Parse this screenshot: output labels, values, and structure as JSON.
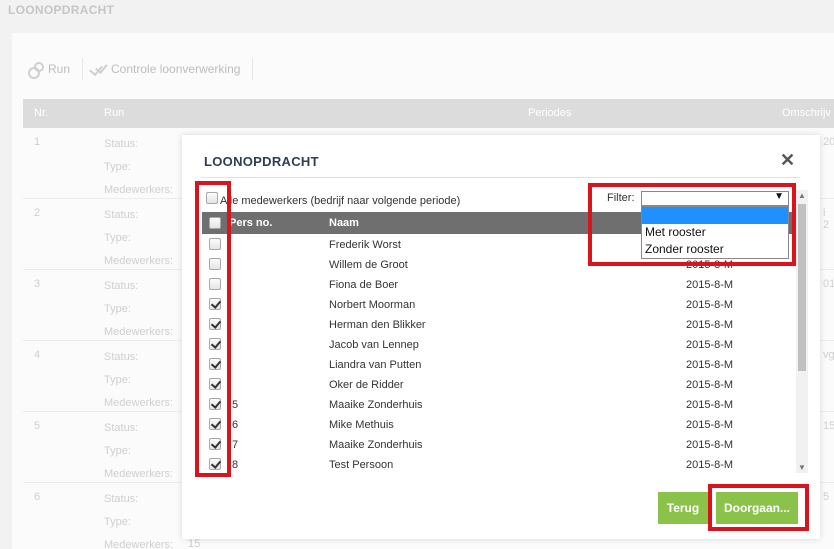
{
  "page": {
    "title": "LOONOPDRACHT",
    "toolbar": {
      "run_label": "Run",
      "check_label": "Controle loonverwerking"
    },
    "table_head": {
      "nr": "Nr.",
      "run": "Run",
      "periodes": "Periodes",
      "omschrijving": "Omschrijv"
    },
    "row_labels": {
      "status": "Status:",
      "type": "Type:",
      "medewerkers": "Medewerkers:"
    },
    "rows": [
      {
        "nr": "1",
        "side": "20"
      },
      {
        "nr": "2",
        "side": "i 2"
      },
      {
        "nr": "3",
        "side": "01"
      },
      {
        "nr": "4",
        "side": "vg"
      },
      {
        "nr": "5",
        "side": "15"
      },
      {
        "nr": "6",
        "side": "5"
      }
    ],
    "last_count": "15"
  },
  "modal": {
    "title": "LOONOPDRACHT",
    "close_symbol": "✕",
    "all_employees_label": "Alle medewerkers (bedrijf naar volgende periode)",
    "filter_label": "Filter:",
    "filter_value": "",
    "filter_arrow": "▼",
    "filter_options": [
      "",
      "Met rooster",
      "Zonder rooster"
    ],
    "columns": {
      "pers": "Pers no.",
      "naam": "Naam"
    },
    "employees": [
      {
        "pers": "",
        "naam": "Frederik Worst",
        "periode": "",
        "checked": false
      },
      {
        "pers": "",
        "naam": "Willem de Groot",
        "periode": "2015-8-M",
        "checked": false
      },
      {
        "pers": "",
        "naam": "Fiona de Boer",
        "periode": "2015-8-M",
        "checked": false
      },
      {
        "pers": "",
        "naam": "Norbert Moorman",
        "periode": "2015-8-M",
        "checked": true
      },
      {
        "pers": "",
        "naam": "Herman den Blikker",
        "periode": "2015-8-M",
        "checked": true
      },
      {
        "pers": "",
        "naam": "Jacob van Lennep",
        "periode": "2015-8-M",
        "checked": true
      },
      {
        "pers": "",
        "naam": "Liandra van Putten",
        "periode": "2015-8-M",
        "checked": true
      },
      {
        "pers": "",
        "naam": "Oker de Ridder",
        "periode": "2015-8-M",
        "checked": true
      },
      {
        "pers": "5",
        "naam": "Maaike Zonderhuis",
        "periode": "2015-8-M",
        "checked": true
      },
      {
        "pers": "6",
        "naam": "Mike Methuis",
        "periode": "2015-8-M",
        "checked": true
      },
      {
        "pers": "7",
        "naam": "Maaike Zonderhuis",
        "periode": "2015-8-M",
        "checked": true
      },
      {
        "pers": "8",
        "naam": "Test Persoon",
        "periode": "2015-8-M",
        "checked": true
      }
    ],
    "buttons": {
      "back": "Terug",
      "continue": "Doorgaan..."
    }
  },
  "colors": {
    "highlight": "#d9141c",
    "button_green": "#8bc34a",
    "table_header": "#6f6f6f",
    "dropdown_selected": "#1e90ff"
  }
}
